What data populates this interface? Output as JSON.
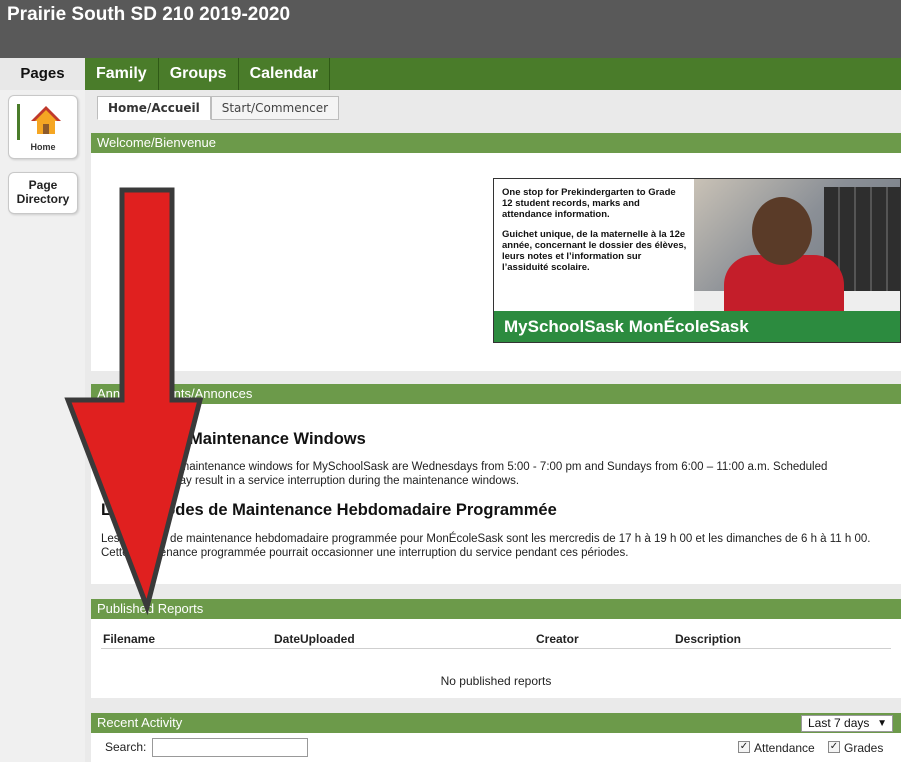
{
  "app": {
    "title": "Prairie South SD 210 2019-2020"
  },
  "nav": {
    "pages_label": "Pages",
    "top_tabs": [
      "Family",
      "Groups",
      "Calendar"
    ]
  },
  "sidebar": {
    "home_label": "Home",
    "directory_label_1": "Page",
    "directory_label_2": "Directory",
    "home_icon": "house-icon"
  },
  "subtabs": {
    "active": "Home/Accueil",
    "inactive": "Start/Commencer"
  },
  "welcome": {
    "heading": "Welcome/Bienvenue",
    "banner": {
      "en": "One stop for Prekindergarten to Grade 12 student records, marks and attendance information.",
      "fr": "Guichet unique, de la maternelle à la 12e année, concernant le dossier des élèves, leurs notes et l’information sur l’assiduité scolaire.",
      "brand": "MySchoolSask MonÉcoleSask"
    }
  },
  "announcements": {
    "heading": "Announcements/Annonces",
    "en_title": "Scheduled Maintenance Windows",
    "en_text": "The scheduled maintenance windows for MySchoolSask are Wednesdays from 5:00 - 7:00 pm and Sundays from 6:00 – 11:00 a.m. Scheduled maintenance may result in a service interruption during the maintenance windows.",
    "fr_title": "Les Périodes de Maintenance Hebdomadaire Programmée",
    "fr_text": "Les périodes de maintenance hebdomadaire programmée pour MonÉcoleSask sont les mercredis de 17 h à 19 h 00 et les dimanches de 6 h à 11 h 00. Cette maintenance programmée pourrait occasionner une interruption du service pendant ces périodes."
  },
  "reports": {
    "heading": "Published Reports",
    "columns": [
      "Filename",
      "DateUploaded",
      "Creator",
      "Description"
    ],
    "empty": "No published reports"
  },
  "activity": {
    "heading": "Recent Activity",
    "range": "Last 7 days",
    "search_label": "Search:",
    "search_value": "",
    "filters": [
      "Attendance",
      "Grades"
    ]
  },
  "colors": {
    "nav_green": "#4a7c2a",
    "panel_green": "#6c9a4a",
    "arrow_red": "#e0201f",
    "brand_green": "#2c8b3f"
  }
}
